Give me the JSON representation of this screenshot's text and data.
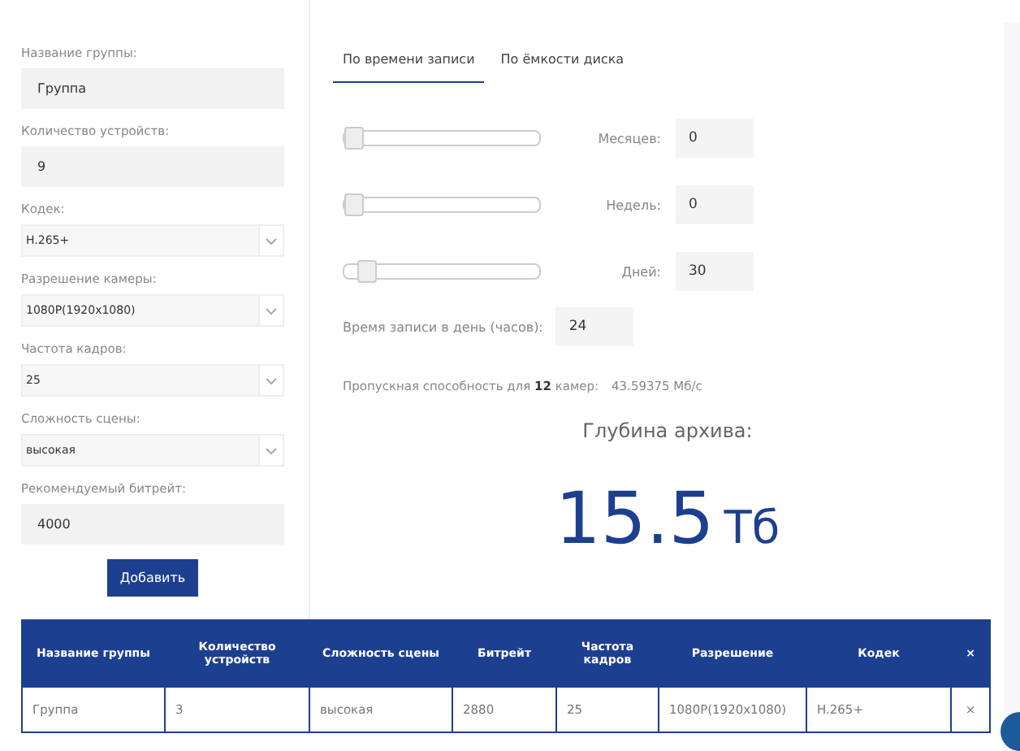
{
  "form": {
    "fields": [
      {
        "kind": "input",
        "label": "Название группы:",
        "value": "Группа"
      },
      {
        "kind": "input",
        "label": "Количество устройств:",
        "value": "9"
      },
      {
        "kind": "select",
        "label": "Кодек:",
        "value": "H.265+"
      },
      {
        "kind": "select",
        "label": "Разрешение камеры:",
        "value": "1080P(1920x1080)"
      },
      {
        "kind": "select",
        "label": "Частота кадров:",
        "value": "25"
      },
      {
        "kind": "select",
        "label": "Сложность сцены:",
        "value": "высокая"
      },
      {
        "kind": "input",
        "label": "Рекомендуемый битрейт:",
        "value": "4000"
      }
    ],
    "add_button": "Добавить"
  },
  "tabs": [
    {
      "label": "По времени записи",
      "selected": true
    },
    {
      "label": "По ёмкости диска",
      "selected": false
    }
  ],
  "sliders": [
    {
      "label": "Месяцев:",
      "value": "0",
      "level": 0
    },
    {
      "label": "Недель:",
      "value": "0",
      "level": 0
    },
    {
      "label": "Дней:",
      "value": "30",
      "level": 0.07
    }
  ],
  "hours": {
    "label": "Время записи в день (часов):",
    "value": "24"
  },
  "bandwidth": {
    "text": "Пропускная способность для **12** камер:",
    "value": "43.59375 Мб/с"
  },
  "archive": {
    "title": "Глубина архива:",
    "number": "15.5",
    "unit": "Тб"
  },
  "table": {
    "columns": [
      "Название группы",
      "Количество устройств",
      "Сложность сцены",
      "Битрейт",
      "Частота кадров",
      "Разрешение",
      "Кодек",
      "×"
    ],
    "rows": [
      [
        "Группа",
        "3",
        "высокая",
        "2880",
        "25",
        "1080P(1920x1080)",
        "H.265+",
        "×"
      ]
    ]
  }
}
